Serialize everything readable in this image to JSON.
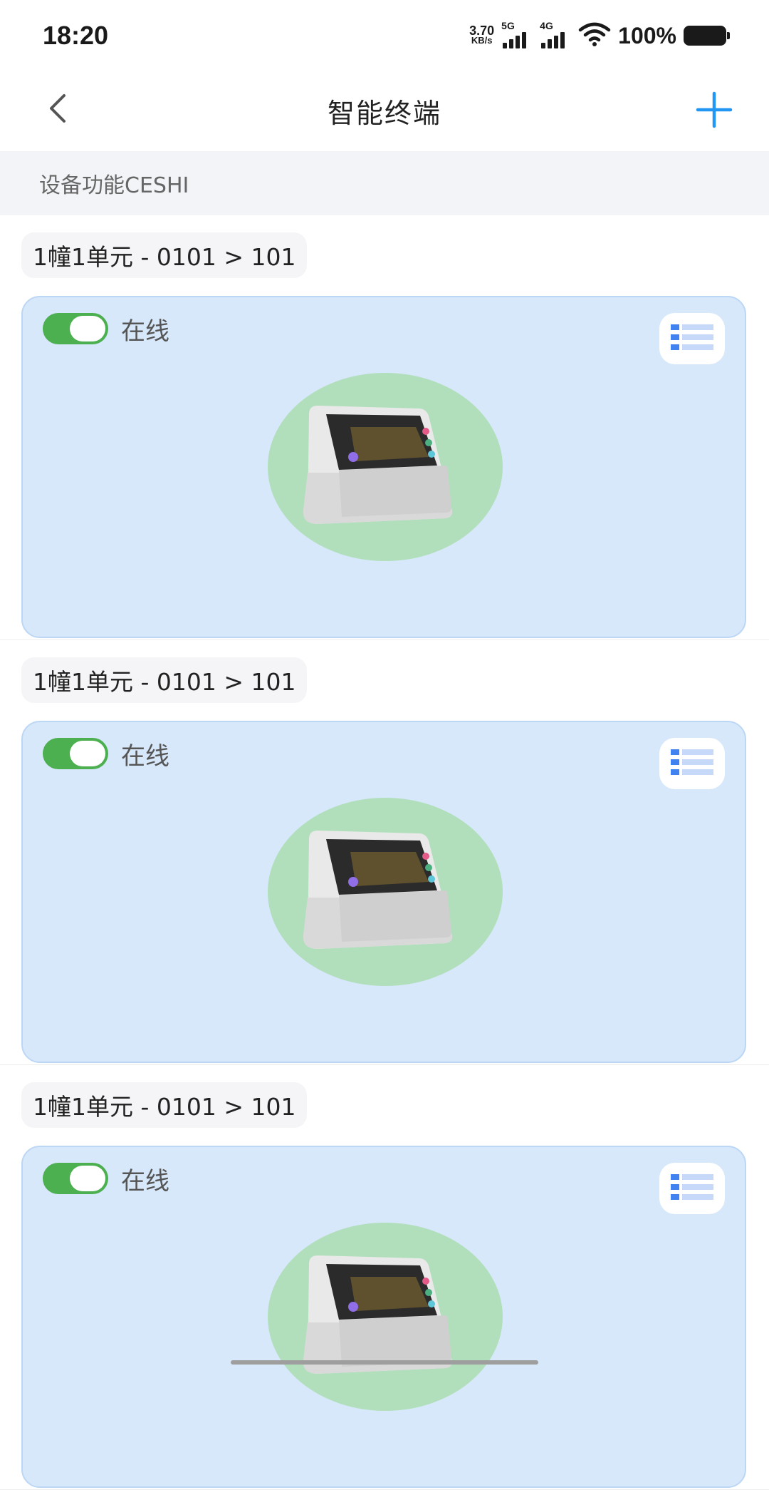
{
  "status_bar": {
    "time": "18:20",
    "net_speed_value": "3.70",
    "net_speed_unit": "KB/s",
    "sim1_label": "5G",
    "sim2_label": "4G",
    "battery_text": "100%",
    "icons": [
      "signal-5g-icon",
      "signal-4g-icon",
      "wifi-icon",
      "battery-icon"
    ]
  },
  "header": {
    "title": "智能终端",
    "back_icon": "chevron-left-icon",
    "add_icon": "plus-icon",
    "accent_color": "#2196f3"
  },
  "section": {
    "title": "设备功能CESHI"
  },
  "devices": [
    {
      "location": "1幢1单元 - 0101 > 101",
      "status": "在线",
      "online": true
    },
    {
      "location": "1幢1单元 - 0101 > 101",
      "status": "在线",
      "online": true
    },
    {
      "location": "1幢1单元 - 0101 > 101",
      "status": "在线",
      "online": true
    }
  ],
  "colors": {
    "card_bg": "#d8e8fb",
    "toggle_on": "#4caf50",
    "image_bg": "#b1dfbc",
    "menu_icon": "#3f82f0"
  }
}
